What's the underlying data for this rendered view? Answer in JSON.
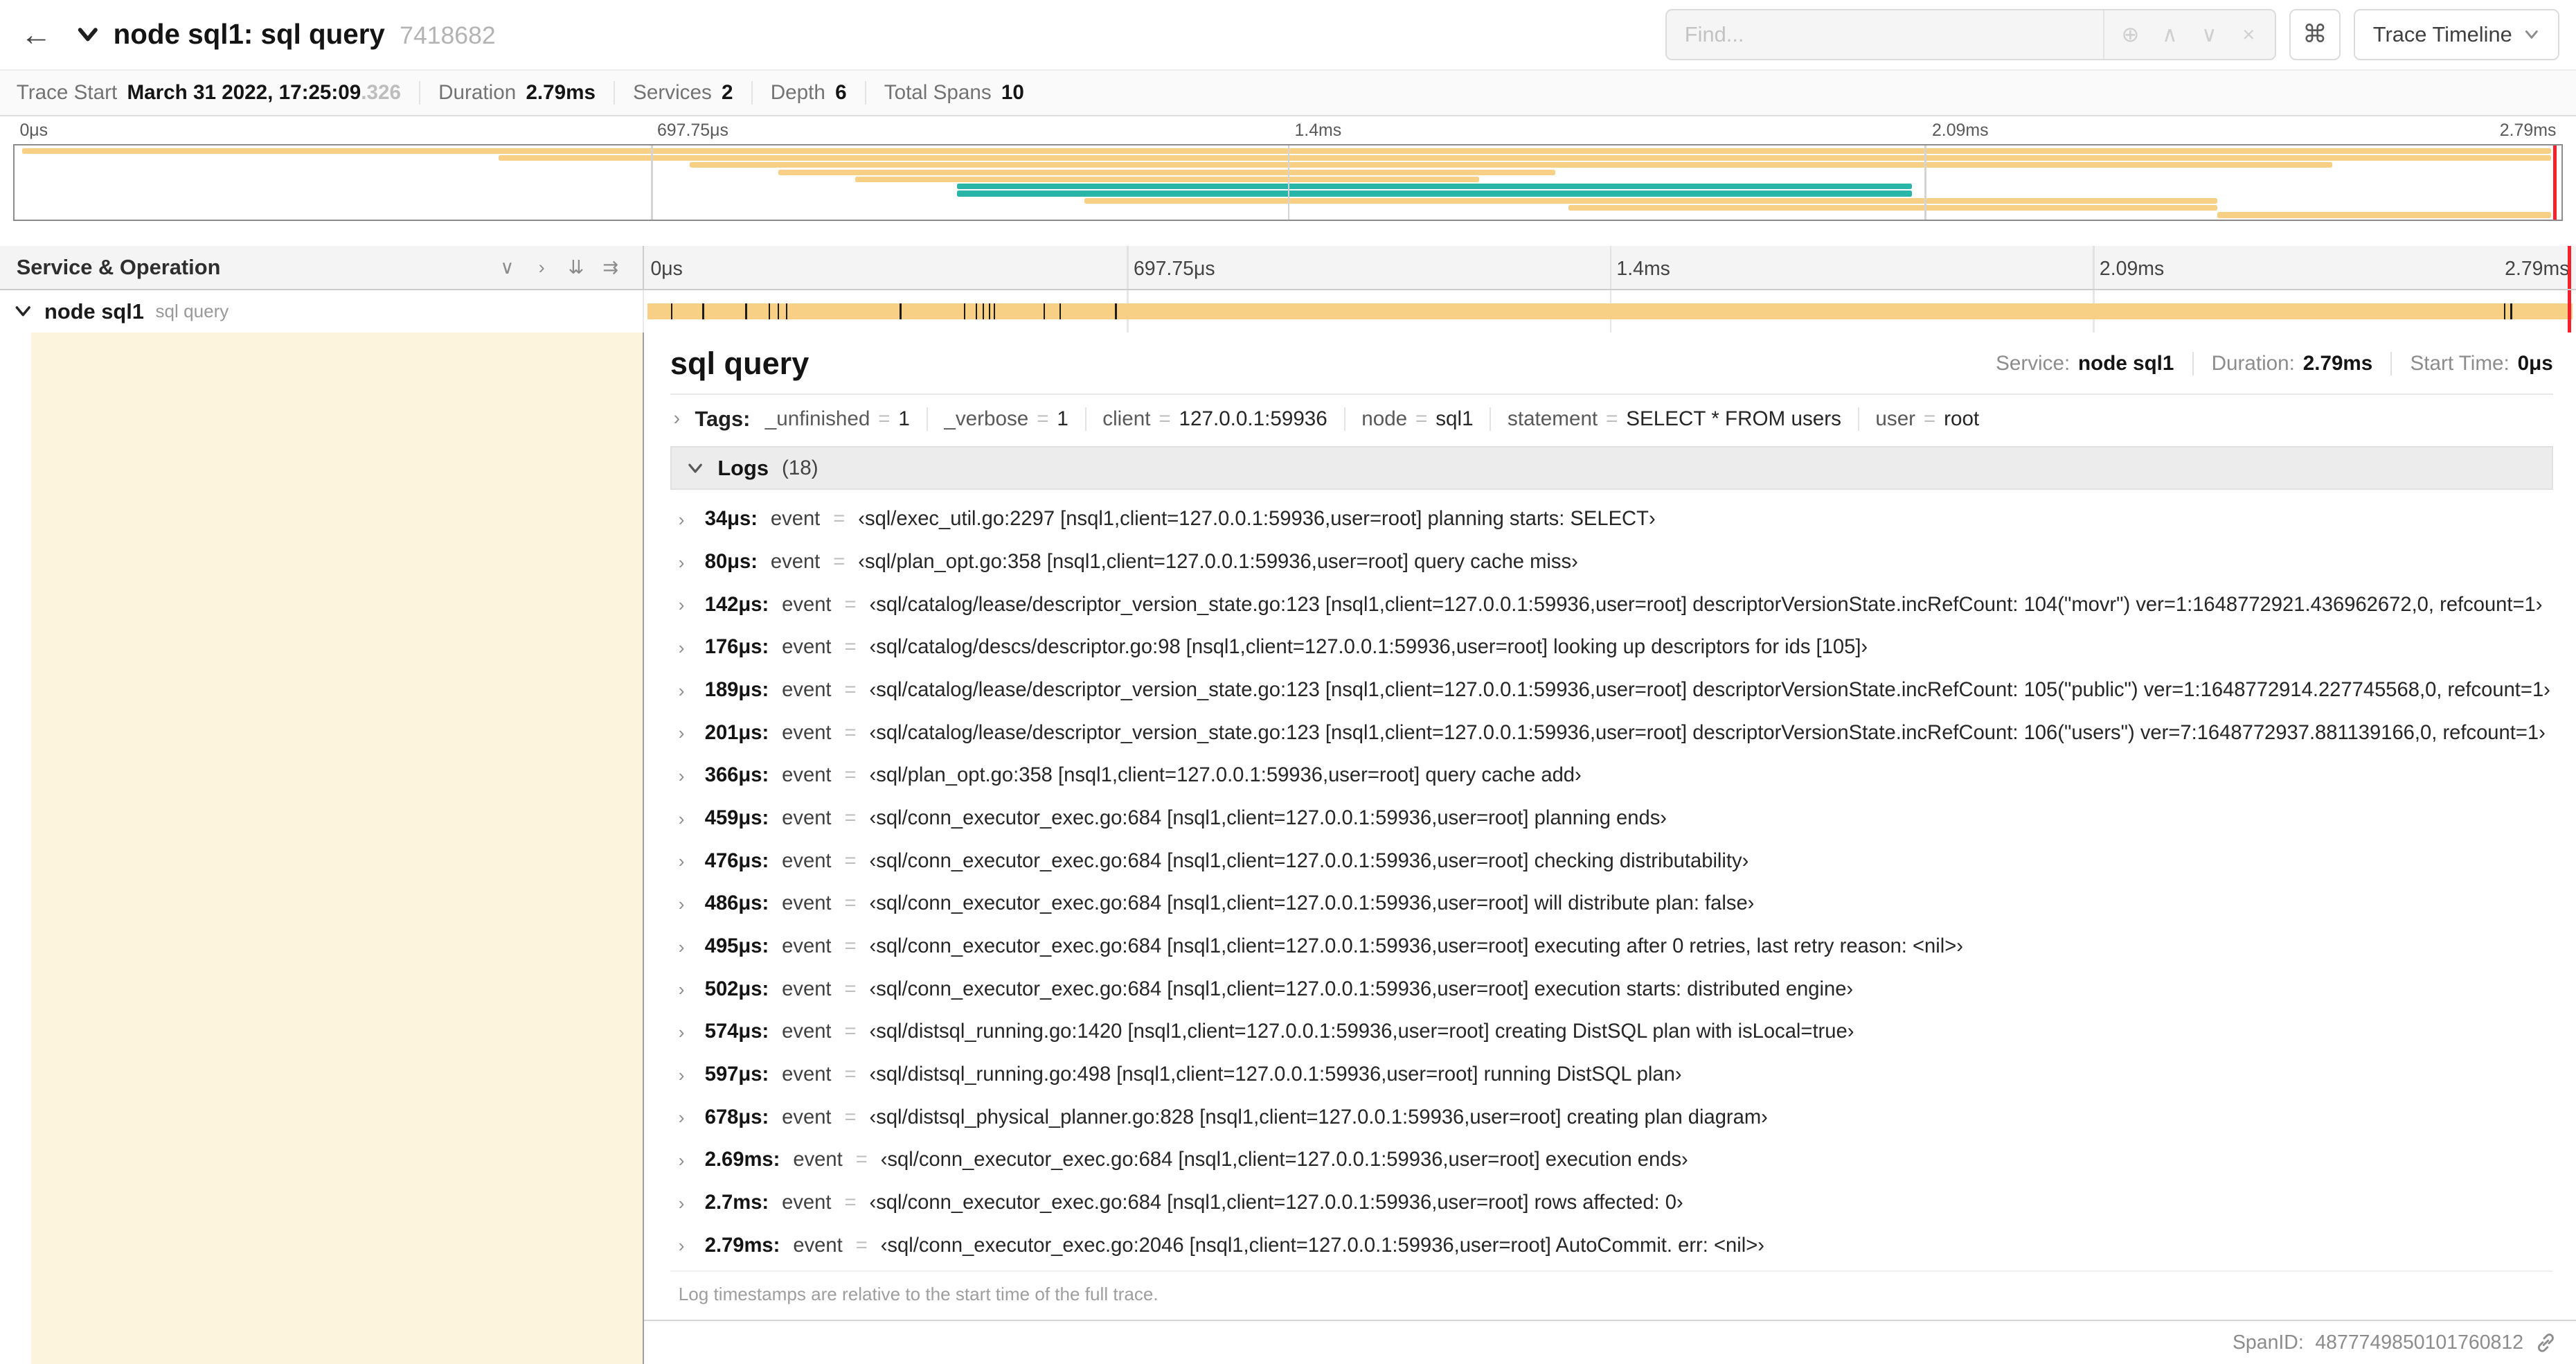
{
  "colors": {
    "tan": "#f7d086",
    "teal": "#29b6a8",
    "cursor": "#f5222d",
    "selected_bg": "#fcf4dd"
  },
  "icons": {
    "back": "←",
    "command": "⌘",
    "focus": "⊕",
    "prev": "∧",
    "next": "∨",
    "clear": "×",
    "chev_right": "›",
    "chev_down": "∨",
    "dbl_down": "⇊",
    "dbl_right": "⇉"
  },
  "header": {
    "title": "node sql1: sql query",
    "trace_id": "7418682",
    "find_placeholder": "Find...",
    "view_dropdown": "Trace Timeline"
  },
  "summary": {
    "items": [
      {
        "label": "Trace Start",
        "value": "March 31 2022, 17:25:09",
        "suffix": ".326"
      },
      {
        "label": "Duration",
        "value": "2.79ms"
      },
      {
        "label": "Services",
        "value": "2"
      },
      {
        "label": "Depth",
        "value": "6"
      },
      {
        "label": "Total Spans",
        "value": "10"
      }
    ]
  },
  "trace": {
    "duration_us": 2790
  },
  "ruler": {
    "ticks": [
      {
        "label": "0μs",
        "pct": 0
      },
      {
        "label": "697.75μs",
        "pct": 25
      },
      {
        "label": "1.4ms",
        "pct": 50
      },
      {
        "label": "2.09ms",
        "pct": 75
      },
      {
        "label": "2.79ms",
        "pct": 100
      }
    ],
    "gridlines": [
      25,
      50,
      75
    ]
  },
  "minimap": {
    "spans": [
      {
        "s": 0.3,
        "e": 99.6,
        "c": "tan"
      },
      {
        "s": 19.0,
        "e": 99.6,
        "c": "tan"
      },
      {
        "s": 26.5,
        "e": 91.0,
        "c": "tan"
      },
      {
        "s": 30.0,
        "e": 60.5,
        "c": "tan"
      },
      {
        "s": 33.0,
        "e": 57.5,
        "c": "tan"
      },
      {
        "s": 37.0,
        "e": 74.5,
        "c": "teal"
      },
      {
        "s": 37.0,
        "e": 74.5,
        "c": "teal"
      },
      {
        "s": 42.0,
        "e": 86.5,
        "c": "tan"
      },
      {
        "s": 61.0,
        "e": 86.5,
        "c": "tan"
      },
      {
        "s": 86.5,
        "e": 99.6,
        "c": "tan"
      }
    ]
  },
  "timeline": {
    "left_header": "Service & Operation",
    "row": {
      "service": "node sql1",
      "operation": "sql query"
    }
  },
  "detail": {
    "title": "sql query",
    "eq": "=",
    "meta": [
      {
        "label": "Service:",
        "value": "node sql1"
      },
      {
        "label": "Duration:",
        "value": "2.79ms"
      },
      {
        "label": "Start Time:",
        "value": "0μs"
      }
    ],
    "tags_label": "Tags:",
    "tags": [
      {
        "key": "_unfinished",
        "value": "1"
      },
      {
        "key": "_verbose",
        "value": "1"
      },
      {
        "key": "client",
        "value": "127.0.0.1:59936"
      },
      {
        "key": "node",
        "value": "sql1"
      },
      {
        "key": "statement",
        "value": "SELECT * FROM users"
      },
      {
        "key": "user",
        "value": "root"
      }
    ],
    "logs_label": "Logs",
    "logs_count": "(18)",
    "logs": [
      {
        "t": 34,
        "time": "34μs:",
        "key": "event",
        "value": "‹sql/exec_util.go:2297 [nsql1,client=127.0.0.1:59936,user=root] planning starts: SELECT›"
      },
      {
        "t": 80,
        "time": "80μs:",
        "key": "event",
        "value": "‹sql/plan_opt.go:358 [nsql1,client=127.0.0.1:59936,user=root] query cache miss›"
      },
      {
        "t": 142,
        "time": "142μs:",
        "key": "event",
        "value": "‹sql/catalog/lease/descriptor_version_state.go:123 [nsql1,client=127.0.0.1:59936,user=root] descriptorVersionState.incRefCount: 104(\"movr\") ver=1:1648772921.436962672,0, refcount=1›"
      },
      {
        "t": 176,
        "time": "176μs:",
        "key": "event",
        "value": "‹sql/catalog/descs/descriptor.go:98 [nsql1,client=127.0.0.1:59936,user=root] looking up descriptors for ids [105]›"
      },
      {
        "t": 189,
        "time": "189μs:",
        "key": "event",
        "value": "‹sql/catalog/lease/descriptor_version_state.go:123 [nsql1,client=127.0.0.1:59936,user=root] descriptorVersionState.incRefCount: 105(\"public\") ver=1:1648772914.227745568,0, refcount=1›"
      },
      {
        "t": 201,
        "time": "201μs:",
        "key": "event",
        "value": "‹sql/catalog/lease/descriptor_version_state.go:123 [nsql1,client=127.0.0.1:59936,user=root] descriptorVersionState.incRefCount: 106(\"users\") ver=7:1648772937.881139166,0, refcount=1›"
      },
      {
        "t": 366,
        "time": "366μs:",
        "key": "event",
        "value": "‹sql/plan_opt.go:358 [nsql1,client=127.0.0.1:59936,user=root] query cache add›"
      },
      {
        "t": 459,
        "time": "459μs:",
        "key": "event",
        "value": "‹sql/conn_executor_exec.go:684 [nsql1,client=127.0.0.1:59936,user=root] planning ends›"
      },
      {
        "t": 476,
        "time": "476μs:",
        "key": "event",
        "value": "‹sql/conn_executor_exec.go:684 [nsql1,client=127.0.0.1:59936,user=root] checking distributability›"
      },
      {
        "t": 486,
        "time": "486μs:",
        "key": "event",
        "value": "‹sql/conn_executor_exec.go:684 [nsql1,client=127.0.0.1:59936,user=root] will distribute plan: false›"
      },
      {
        "t": 495,
        "time": "495μs:",
        "key": "event",
        "value": "‹sql/conn_executor_exec.go:684 [nsql1,client=127.0.0.1:59936,user=root] executing after 0 retries, last retry reason: <nil>›"
      },
      {
        "t": 502,
        "time": "502μs:",
        "key": "event",
        "value": "‹sql/conn_executor_exec.go:684 [nsql1,client=127.0.0.1:59936,user=root] execution starts: distributed engine›"
      },
      {
        "t": 574,
        "time": "574μs:",
        "key": "event",
        "value": "‹sql/distsql_running.go:1420 [nsql1,client=127.0.0.1:59936,user=root] creating DistSQL plan with isLocal=true›"
      },
      {
        "t": 597,
        "time": "597μs:",
        "key": "event",
        "value": "‹sql/distsql_running.go:498 [nsql1,client=127.0.0.1:59936,user=root] running DistSQL plan›"
      },
      {
        "t": 678,
        "time": "678μs:",
        "key": "event",
        "value": "‹sql/distsql_physical_planner.go:828 [nsql1,client=127.0.0.1:59936,user=root] creating plan diagram›"
      },
      {
        "t": 2690,
        "time": "2.69ms:",
        "key": "event",
        "value": "‹sql/conn_executor_exec.go:684 [nsql1,client=127.0.0.1:59936,user=root] execution ends›"
      },
      {
        "t": 2700,
        "time": "2.7ms:",
        "key": "event",
        "value": "‹sql/conn_executor_exec.go:684 [nsql1,client=127.0.0.1:59936,user=root] rows affected: 0›"
      },
      {
        "t": 2790,
        "time": "2.79ms:",
        "key": "event",
        "value": "‹sql/conn_executor_exec.go:2046 [nsql1,client=127.0.0.1:59936,user=root] AutoCommit. err: <nil>›"
      }
    ],
    "footer": "Log timestamps are relative to the start time of the full trace.",
    "span_id_label": "SpanID:",
    "span_id": "4877749850101760812"
  }
}
